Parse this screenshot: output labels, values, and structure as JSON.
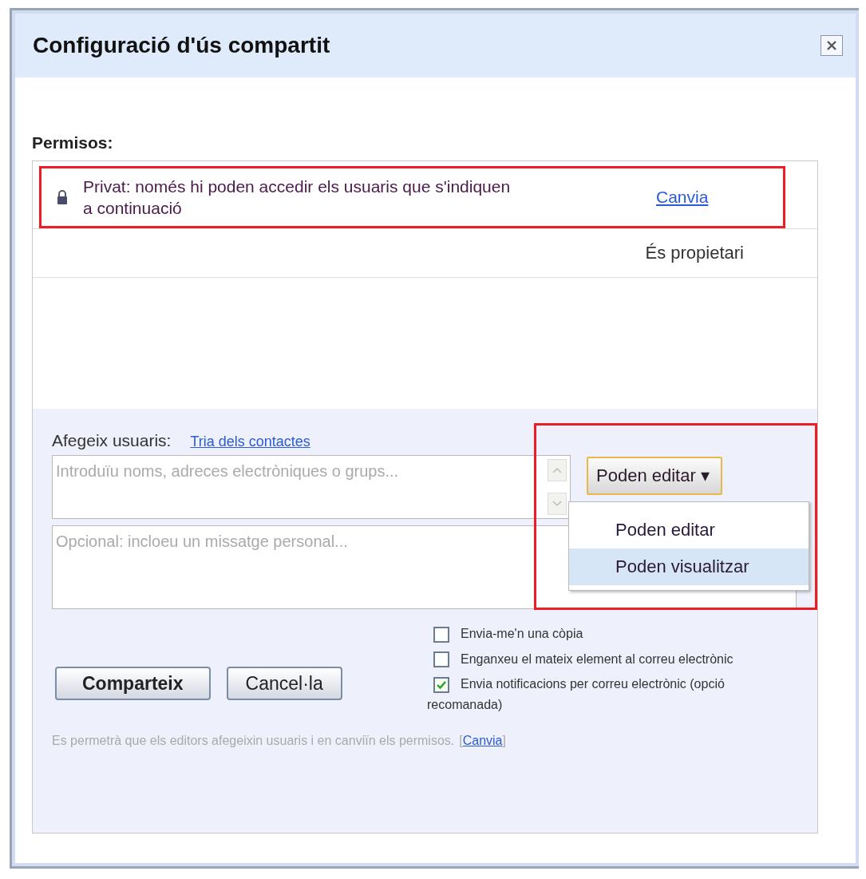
{
  "dialog": {
    "title": "Configuració d'ús compartit"
  },
  "permissions": {
    "label": "Permisos:",
    "privacy": {
      "text": "Privat: només hi poden accedir els usuaris que s'indiquen a continuació",
      "link": "Canvia",
      "highlighted": true
    },
    "owner": {
      "role": "És propietari"
    }
  },
  "add_users": {
    "label": "Afegeix usuaris:",
    "contacts_link": "Tria dels contactes",
    "names_field": {
      "placeholder": "Introduïu noms, adreces electròniques o grups..."
    },
    "message_field": {
      "placeholder": "Opcional: incloeu un missatge personal..."
    },
    "permission_button": {
      "label": "Poden editar",
      "arrow": "▾"
    },
    "dropdown": {
      "highlighted": true,
      "items": [
        {
          "label": "Poden editar",
          "selected": false
        },
        {
          "label": "Poden visualitzar",
          "selected": true
        }
      ]
    }
  },
  "checkboxes": [
    {
      "label": "Envia-me'n una còpia",
      "checked": false
    },
    {
      "label": "Enganxeu el mateix element al correu electrònic",
      "checked": false
    },
    {
      "label": "Envia notificacions per correu electrònic (opció recomanada)",
      "checked": true
    }
  ],
  "buttons": [
    {
      "label": "Comparteix",
      "primary": true
    },
    {
      "label": "Cancel·la",
      "primary": false
    }
  ],
  "note": {
    "text": "Es permetrà que els editors afegeixin usuaris i en canviïn els permisos.",
    "open": "[",
    "link": "Canvia",
    "close": "]"
  }
}
